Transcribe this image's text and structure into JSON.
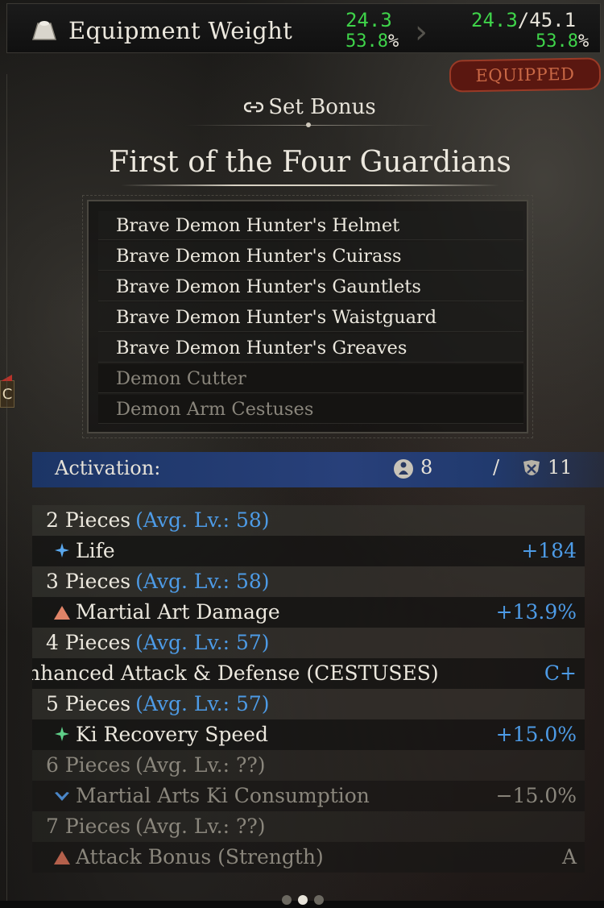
{
  "weight": {
    "icon": "weight-stone-icon",
    "title": "Equipment Weight",
    "current_value": "24.3",
    "current_percent": "53.8",
    "new_value": "24.3",
    "max_value": "/45.1",
    "new_percent": "53.8",
    "percent_sign": "%",
    "arrow": "›",
    "value_color": "#3fd44a"
  },
  "equipped_label": "EQUIPPED",
  "side_tab_label": "C",
  "set_bonus": {
    "header": "Set Bonus",
    "header_icon": "link-icon",
    "set_name": "First of the Four Guardians",
    "pieces": [
      {
        "label": "Brave Demon Hunter's Helmet",
        "equipped": true
      },
      {
        "label": "Brave Demon Hunter's Cuirass",
        "equipped": true
      },
      {
        "label": "Brave Demon Hunter's Gauntlets",
        "equipped": true
      },
      {
        "label": "Brave Demon Hunter's Waistguard",
        "equipped": true
      },
      {
        "label": "Brave Demon Hunter's Greaves",
        "equipped": true
      },
      {
        "label": "Demon Cutter",
        "equipped": false
      },
      {
        "label": "Demon Arm Cestuses",
        "equipped": false
      }
    ]
  },
  "activation": {
    "label": "Activation:",
    "equipped_count": "8",
    "separator": "/",
    "total_count": "11"
  },
  "tiers": [
    {
      "count": "2 Pieces",
      "avg": "(Avg. Lv.: 58)",
      "icon": "sparkle-icon",
      "stat": "Life",
      "value": "+184",
      "active": true
    },
    {
      "count": "3 Pieces",
      "avg": "(Avg. Lv.: 58)",
      "icon": "triangle-up-icon",
      "stat": "Martial Art Damage",
      "value": "+13.9%",
      "active": true
    },
    {
      "count": "4 Pieces",
      "avg": "(Avg. Lv.: 57)",
      "icon": "",
      "stat": "nhanced Attack & Defense (CESTUSES)",
      "value": "C+",
      "active": true
    },
    {
      "count": "5 Pieces",
      "avg": "(Avg. Lv.: 57)",
      "icon": "sparkle-icon",
      "stat": "Ki Recovery Speed",
      "value": "+15.0%",
      "active": true
    },
    {
      "count": "6 Pieces",
      "avg": "(Avg. Lv.: ??)",
      "icon": "chevron-down-icon",
      "stat": "Martial Arts Ki Consumption",
      "value": "−15.0%",
      "active": false
    },
    {
      "count": "7 Pieces",
      "avg": "(Avg. Lv.: ??)",
      "icon": "triangle-up-icon",
      "stat": "Attack Bonus (Strength)",
      "value": "A",
      "active": false
    }
  ],
  "colors": {
    "accent_blue": "#4d9be6",
    "activation_bar": "#28407a",
    "equipped_tag": "#5a1710",
    "positive_green": "#3fd44a"
  }
}
